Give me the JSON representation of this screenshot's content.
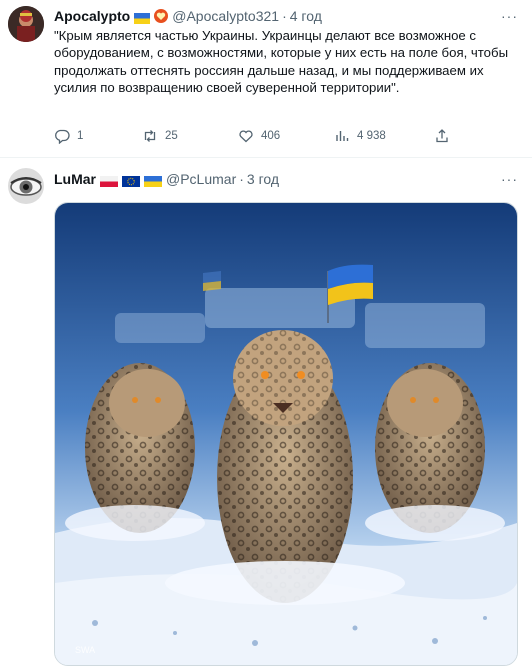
{
  "tweets": [
    {
      "author_name": "Apocalypto",
      "handle": "@Apocalypto321",
      "separator": "·",
      "time": "4 год",
      "more": "···",
      "text": "\"Крым является частью Украины. Украинцы делают все возможное с оборудованием, с возможностями, которые у них есть на поле боя, чтобы продолжать оттеснять россиян дальше назад, и мы поддерживаем их усилия по возвращению своей суверенной территории\".",
      "flags": [
        "ukraine",
        "heart-badge"
      ],
      "actions": {
        "replies": "1",
        "retweets": "25",
        "likes": "406",
        "views": "4 938"
      }
    },
    {
      "author_name": "LuMar",
      "handle": "@PcLumar",
      "separator": "·",
      "time": "3 год",
      "more": "···",
      "flags": [
        "poland",
        "eu",
        "ukraine"
      ],
      "image_watermark": "SWA"
    }
  ],
  "colors": {
    "text": "#0f1419",
    "secondary": "#536471",
    "divider": "#eff3f4"
  }
}
